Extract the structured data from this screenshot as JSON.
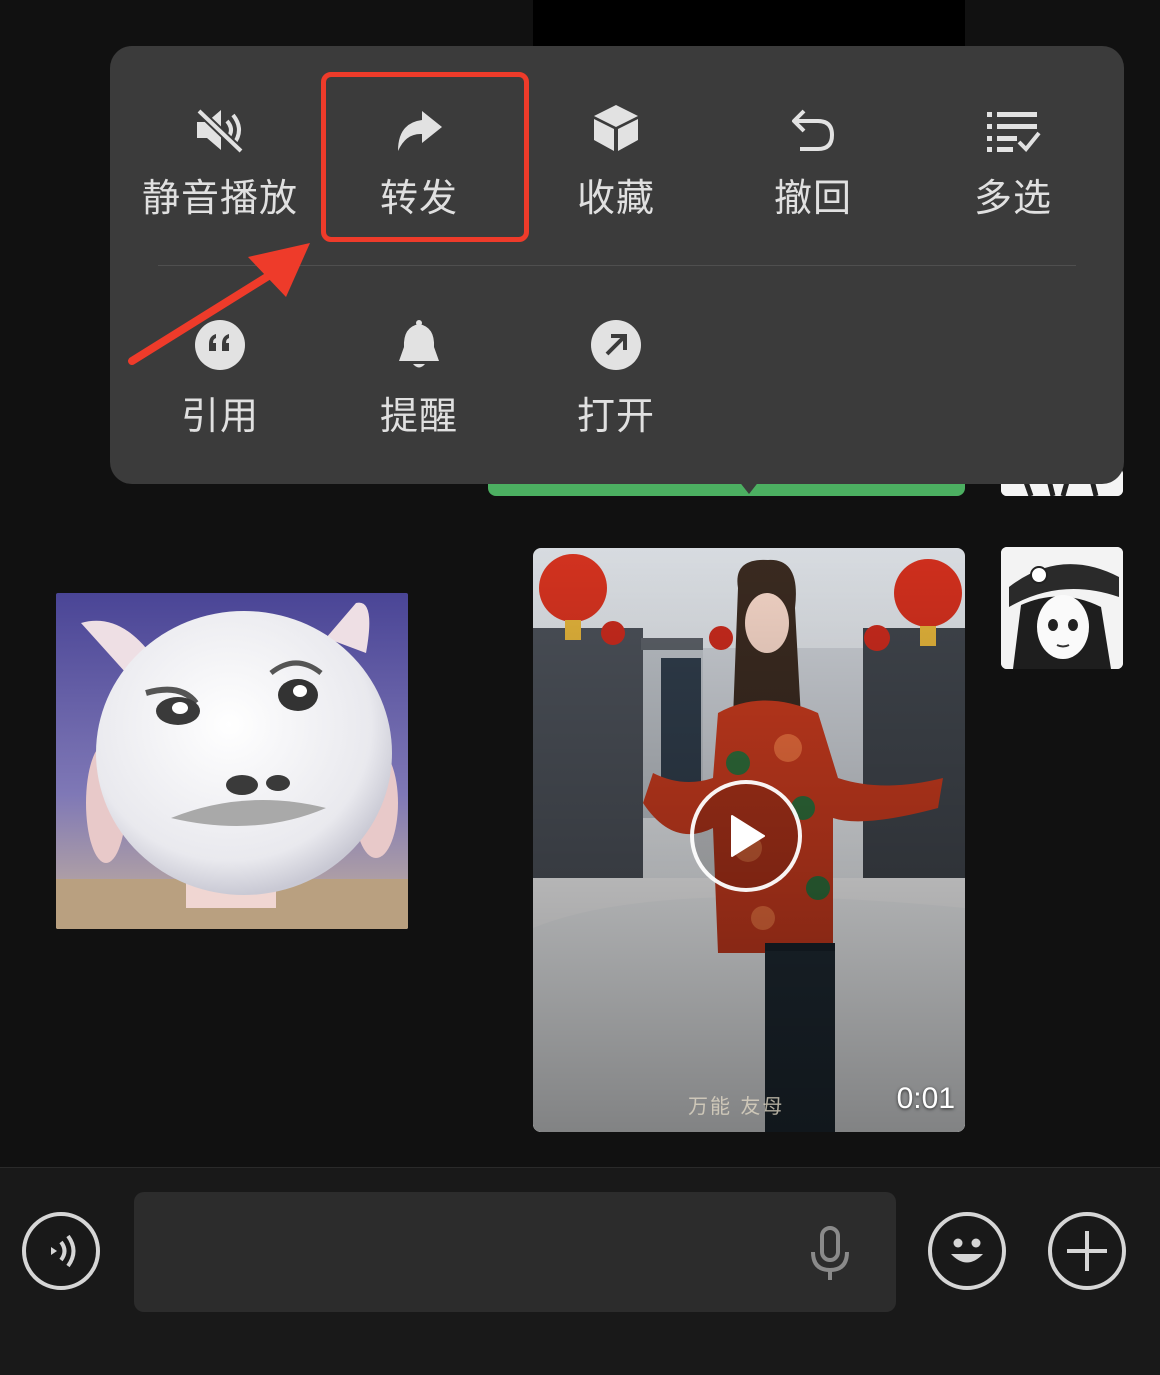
{
  "menu": {
    "row1": [
      {
        "label": "静音播放",
        "icon": "mute-speaker-icon"
      },
      {
        "label": "转发",
        "icon": "forward-arrow-icon"
      },
      {
        "label": "收藏",
        "icon": "cube-icon"
      },
      {
        "label": "撤回",
        "icon": "undo-arrow-icon"
      },
      {
        "label": "多选",
        "icon": "multi-select-list-icon"
      }
    ],
    "row2": [
      {
        "label": "引用",
        "icon": "quote-icon"
      },
      {
        "label": "提醒",
        "icon": "bell-icon"
      },
      {
        "label": "打开",
        "icon": "open-external-icon"
      }
    ],
    "highlighted": "转发"
  },
  "video_message": {
    "duration": "0:01",
    "watermark": "万能 友母"
  },
  "input_bar": {
    "icons": [
      "voice-toggle-icon",
      "microphone-icon",
      "emoji-icon",
      "plus-icon"
    ]
  },
  "colors": {
    "background": "#111111",
    "popup": "#3b3b3b",
    "highlight": "#ee3b2a",
    "sent_bubble": "#4caf61"
  }
}
